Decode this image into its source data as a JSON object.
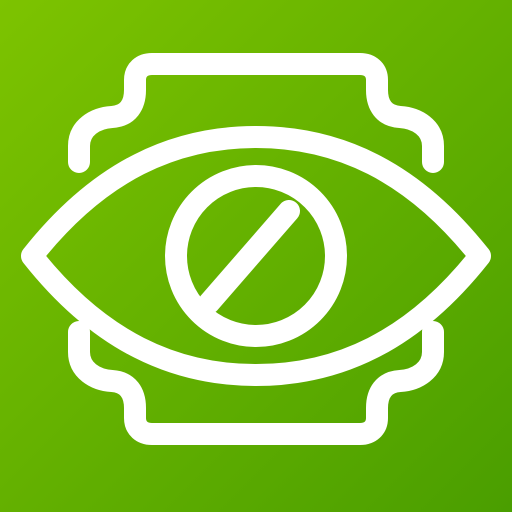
{
  "icon": {
    "name": "eye-blocked-badge-icon",
    "colors": {
      "gradient_start": "#7dc300",
      "gradient_end": "#4a9e00",
      "stroke": "#ffffff"
    }
  }
}
